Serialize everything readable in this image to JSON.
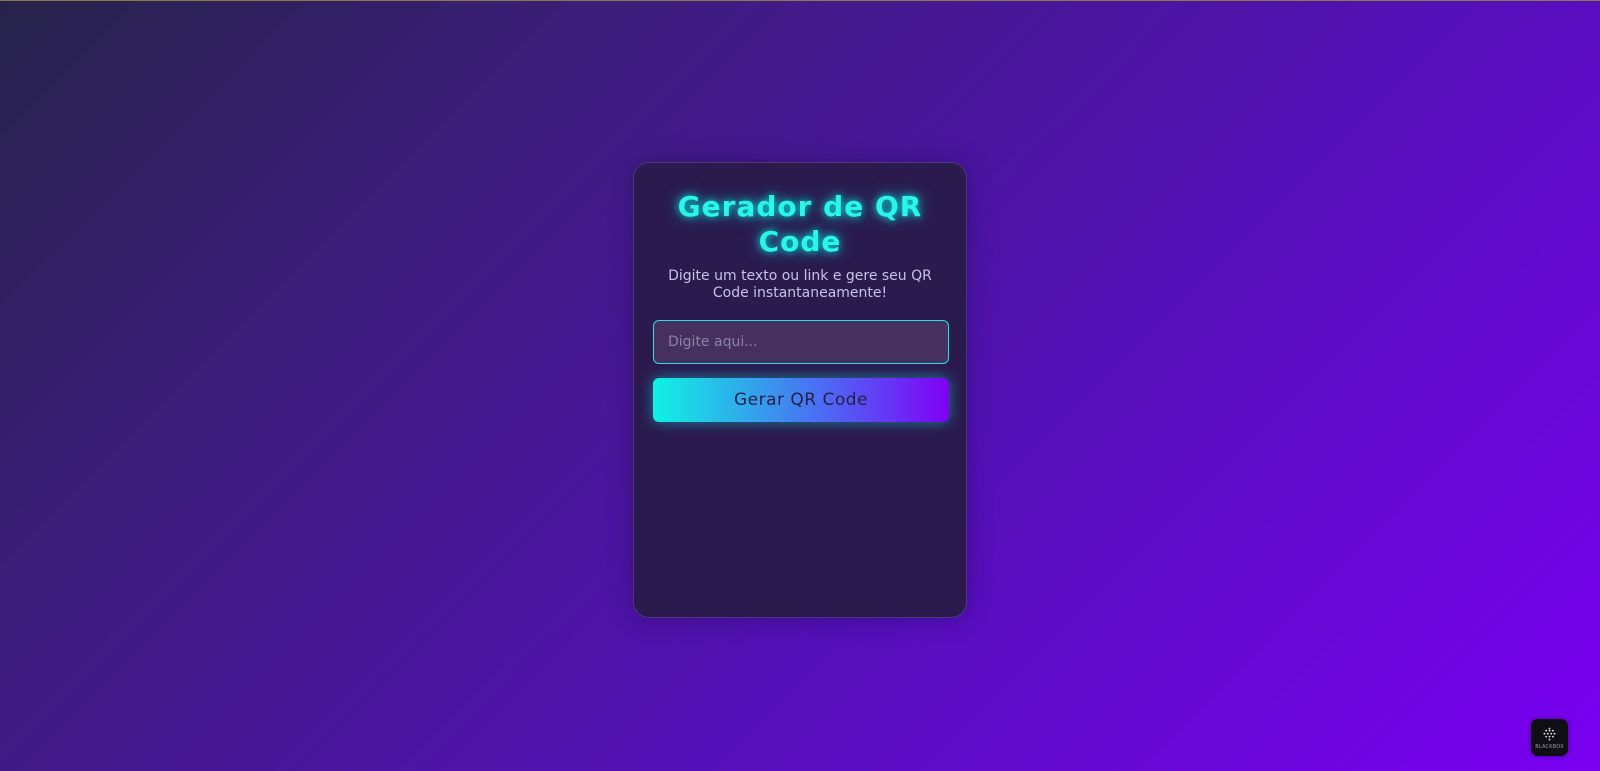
{
  "app": {
    "title": "Gerador de QR Code",
    "subtitle": "Digite um texto ou link e gere seu QR Code instantaneamente!"
  },
  "form": {
    "input_value": "",
    "input_placeholder": "Digite aqui...",
    "generate_label": "Gerar QR Code"
  },
  "badge": {
    "label": "BLACKBOX",
    "icon": "blackbox-logo-icon"
  },
  "colors": {
    "accent": "#2af5e8",
    "background_start": "#26234a",
    "background_end": "#7a00f2",
    "card": "#2a1a4e"
  }
}
